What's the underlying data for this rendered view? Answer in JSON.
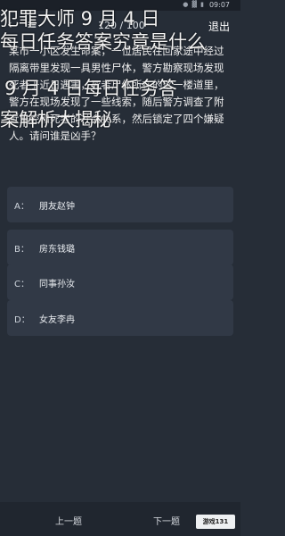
{
  "status": {
    "icons": "● ▓ ▮",
    "time": "09:07"
  },
  "topbar": {
    "timer": "120 / 100",
    "exit_label": "退出"
  },
  "overlay": {
    "line1": "犯罪大师 9 月 4 日",
    "line2": "每日任务答案究竟是什么",
    "line3": "9 月 4 日每日任务答",
    "line4": "案解析大揭秘"
  },
  "question": {
    "text": "某市一小区发生命案，一位居民在回家途中经过隔离带里发现一具男性尸体，警方勘察现场发现死者于近日遇害，死者尸体所在的这一楼道里，警方在现场发现了一些线索，随后警方调查了附近监控和死者的社会关系，然后锁定了四个嫌疑人。请问谁是凶手？"
  },
  "options": [
    {
      "letter": "A：",
      "text": "朋友赵钟"
    },
    {
      "letter": "B：",
      "text": "房东钱璐"
    },
    {
      "letter": "C：",
      "text": "同事孙汝"
    },
    {
      "letter": "D：",
      "text": "女友李冉"
    }
  ],
  "bottom": {
    "prev_label": "上一题",
    "next_label": "下一题",
    "logo_text": "游戏131"
  }
}
